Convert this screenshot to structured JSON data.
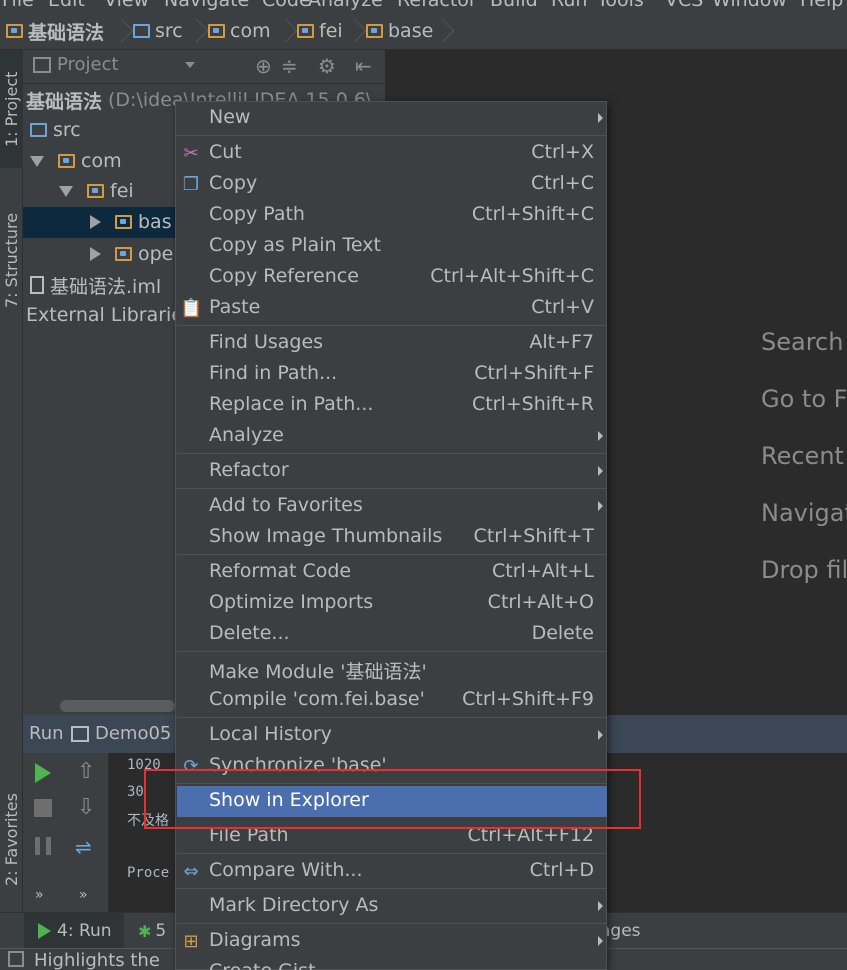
{
  "menubar": [
    "File",
    "Edit",
    "View",
    "Navigate",
    "Code",
    "Analyze",
    "Refactor",
    "Build",
    "Run",
    "Tools",
    "VCS",
    "Window",
    "Help"
  ],
  "breadcrumb": [
    "基础语法",
    "src",
    "com",
    "fei",
    "base"
  ],
  "sidebar_tabs": {
    "project": "1: Project",
    "structure": "7: Structure",
    "favorites": "2: Favorites"
  },
  "project_panel": {
    "view_label": "Project",
    "root_name": "基础语法",
    "root_path": "(D:\\idea\\IntelliJ IDEA 15.0.6\\",
    "items": [
      "src",
      "com",
      "fei",
      "bas",
      "ope",
      "基础语法.iml",
      "External Librarie"
    ]
  },
  "editor_hints": [
    "Search",
    "Go to F",
    "Recent",
    "Navigat",
    "Drop fil"
  ],
  "run_panel": {
    "title": "Run",
    "config": "Demo05",
    "console": [
      "1020",
      "30",
      "不及格",
      "Proce"
    ]
  },
  "bottom_tabs": {
    "run": "4: Run",
    "debug": "5",
    "messages": "ages"
  },
  "status_text": "Highlights the",
  "context_menu": [
    {
      "label": "New",
      "shortcut": "",
      "submenu": true
    },
    {
      "label": "Cut",
      "shortcut": "Ctrl+X",
      "icon": "scissors"
    },
    {
      "label": "Copy",
      "shortcut": "Ctrl+C",
      "icon": "copy"
    },
    {
      "label": "Copy Path",
      "shortcut": "Ctrl+Shift+C"
    },
    {
      "label": "Copy as Plain Text",
      "shortcut": ""
    },
    {
      "label": "Copy Reference",
      "shortcut": "Ctrl+Alt+Shift+C"
    },
    {
      "label": "Paste",
      "shortcut": "Ctrl+V",
      "icon": "paste"
    },
    {
      "label": "Find Usages",
      "shortcut": "Alt+F7"
    },
    {
      "label": "Find in Path...",
      "shortcut": "Ctrl+Shift+F"
    },
    {
      "label": "Replace in Path...",
      "shortcut": "Ctrl+Shift+R"
    },
    {
      "label": "Analyze",
      "shortcut": "",
      "submenu": true
    },
    {
      "label": "Refactor",
      "shortcut": "",
      "submenu": true
    },
    {
      "label": "Add to Favorites",
      "shortcut": "",
      "submenu": true
    },
    {
      "label": "Show Image Thumbnails",
      "shortcut": "Ctrl+Shift+T"
    },
    {
      "label": "Reformat Code",
      "shortcut": "Ctrl+Alt+L"
    },
    {
      "label": "Optimize Imports",
      "shortcut": "Ctrl+Alt+O"
    },
    {
      "label": "Delete...",
      "shortcut": "Delete"
    },
    {
      "label": "Make Module '基础语法'",
      "shortcut": ""
    },
    {
      "label": "Compile 'com.fei.base'",
      "shortcut": "Ctrl+Shift+F9"
    },
    {
      "label": "Local History",
      "shortcut": "",
      "submenu": true
    },
    {
      "label": "Synchronize 'base'",
      "shortcut": "",
      "icon": "sync"
    },
    {
      "label": "Show in Explorer",
      "shortcut": "",
      "selected": true
    },
    {
      "label": "File Path",
      "shortcut": "Ctrl+Alt+F12"
    },
    {
      "label": "Compare With...",
      "shortcut": "Ctrl+D",
      "icon": "compare"
    },
    {
      "label": "Mark Directory As",
      "shortcut": "",
      "submenu": true
    },
    {
      "label": "Diagrams",
      "shortcut": "",
      "submenu": true,
      "icon": "diagram"
    },
    {
      "label": "Create Gist",
      "shortcut": ""
    }
  ],
  "colors": {
    "selection": "#4b6eaf",
    "highlight_box": "#e8312f",
    "run_header": "#3b4754"
  }
}
